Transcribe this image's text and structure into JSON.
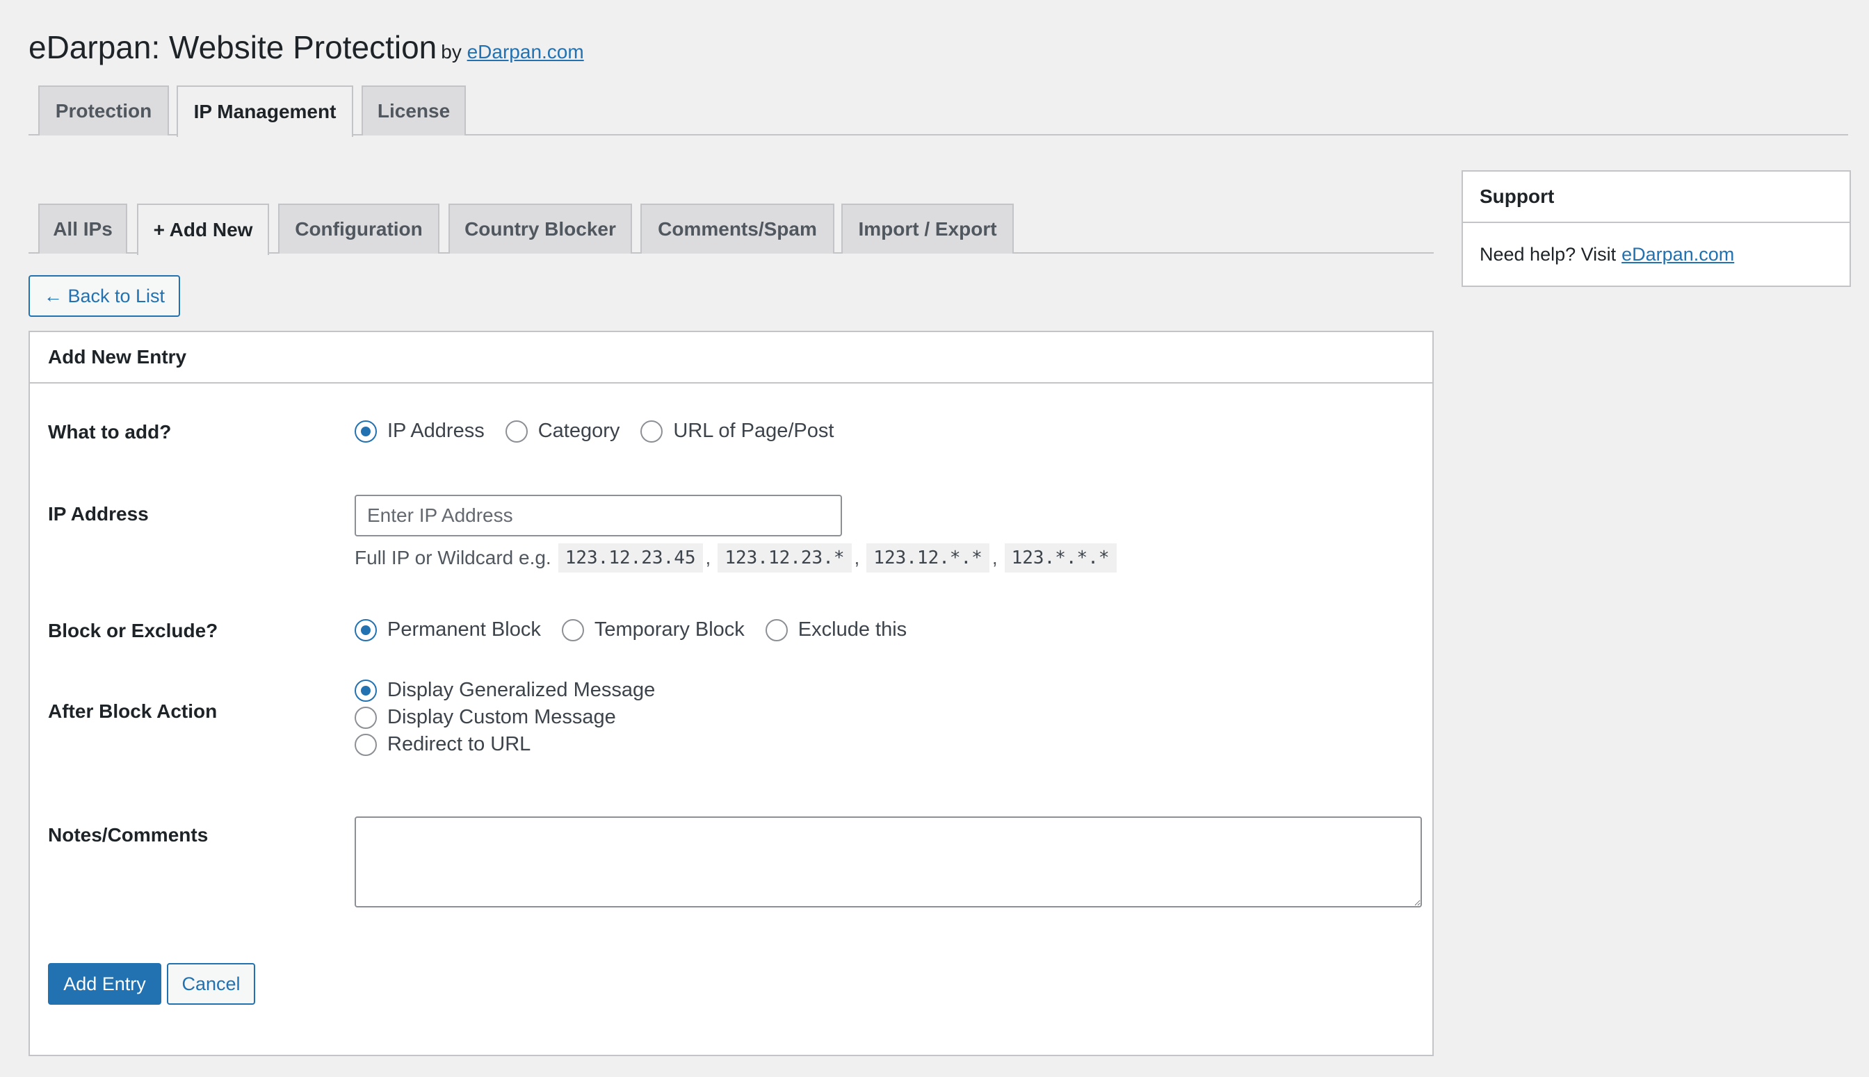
{
  "header": {
    "title": "eDarpan: Website Protection",
    "by_label": "by",
    "by_link": "eDarpan.com"
  },
  "main_tabs": [
    {
      "label": "Protection",
      "active": false
    },
    {
      "label": "IP Management",
      "active": true
    },
    {
      "label": "License",
      "active": false
    }
  ],
  "sub_tabs": [
    {
      "label": "All IPs",
      "active": false
    },
    {
      "label": "+ Add New",
      "active": true
    },
    {
      "label": "Configuration",
      "active": false
    },
    {
      "label": "Country Blocker",
      "active": false
    },
    {
      "label": "Comments/Spam",
      "active": false
    },
    {
      "label": "Import / Export",
      "active": false
    }
  ],
  "back_button": "← Back to List",
  "form": {
    "heading": "Add New Entry",
    "what_to_add": {
      "label": "What to add?",
      "options": [
        "IP Address",
        "Category",
        "URL of Page/Post"
      ],
      "selected": "IP Address"
    },
    "ip_address": {
      "label": "IP Address",
      "value": "",
      "placeholder": "Enter IP Address",
      "hint": "Full IP or Wildcard e.g.",
      "examples": [
        "123.12.23.45",
        "123.12.23.*",
        "123.12.*.*",
        "123.*.*.*"
      ],
      "separator": ","
    },
    "block_or_exclude": {
      "label": "Block or Exclude?",
      "options": [
        "Permanent Block",
        "Temporary Block",
        "Exclude this"
      ],
      "selected": "Permanent Block"
    },
    "after_block_action": {
      "label": "After Block Action",
      "options": [
        "Display Generalized Message",
        "Display Custom Message",
        "Redirect to URL"
      ],
      "selected": "Display Generalized Message"
    },
    "notes": {
      "label": "Notes/Comments",
      "value": ""
    },
    "submit_label": "Add Entry",
    "cancel_label": "Cancel"
  },
  "support": {
    "title": "Support",
    "text": "Need help? Visit",
    "link": "eDarpan.com"
  },
  "colors": {
    "accent": "#2271b1",
    "background": "#f0f0f1",
    "border": "#c3c4c7"
  }
}
